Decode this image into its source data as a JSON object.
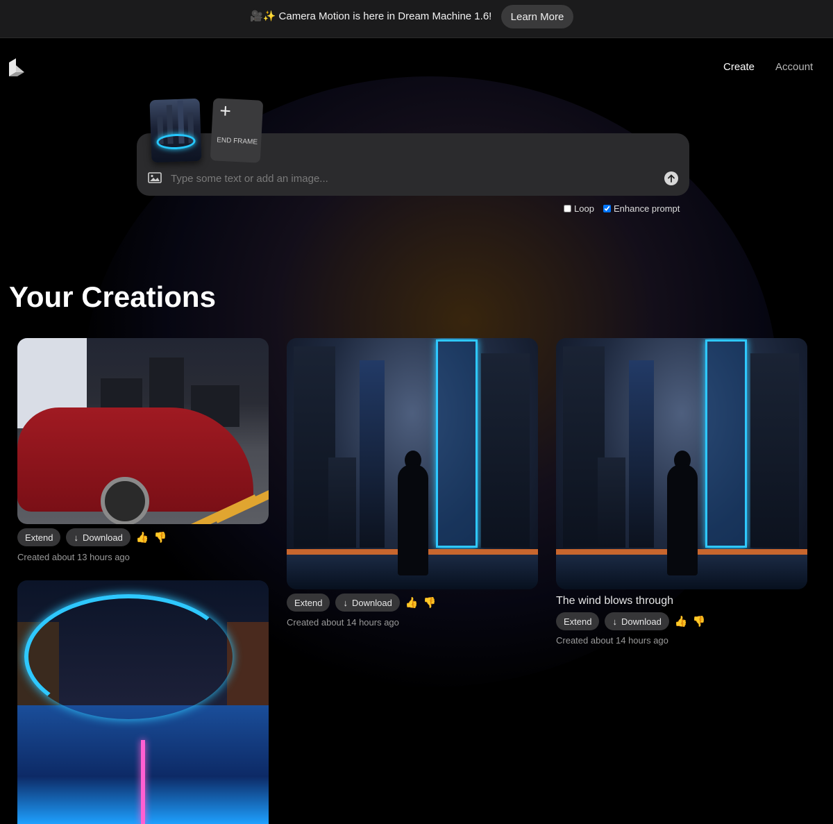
{
  "banner": {
    "emoji": "🎥✨",
    "text": "Camera Motion is here in Dream Machine 1.6!",
    "button_label": "Learn More"
  },
  "nav": {
    "create": "Create",
    "account": "Account"
  },
  "prompt": {
    "end_frame_label": "END FRAME",
    "plus": "+",
    "placeholder": "Type some text or add an image...",
    "value": "",
    "loop_label": "Loop",
    "loop_checked": false,
    "enhance_label": "Enhance prompt",
    "enhance_checked": true
  },
  "creations_title": "Your Creations",
  "actions": {
    "extend": "Extend",
    "download": "Download"
  },
  "cards": [
    {
      "caption": "",
      "meta": "Created about 13 hours ago"
    },
    {
      "caption": "",
      "meta": "Created about 14 hours ago"
    },
    {
      "caption": "The wind blows through",
      "meta": "Created about 14 hours ago"
    }
  ],
  "colors": {
    "accent_neon": "#2ec8ff",
    "background": "#000000",
    "pill": "#363638"
  },
  "icons": [
    "logo-icon",
    "image-icon",
    "arrow-up-icon",
    "download-arrow-icon",
    "thumbs-up-icon",
    "thumbs-down-icon",
    "plus-icon"
  ]
}
